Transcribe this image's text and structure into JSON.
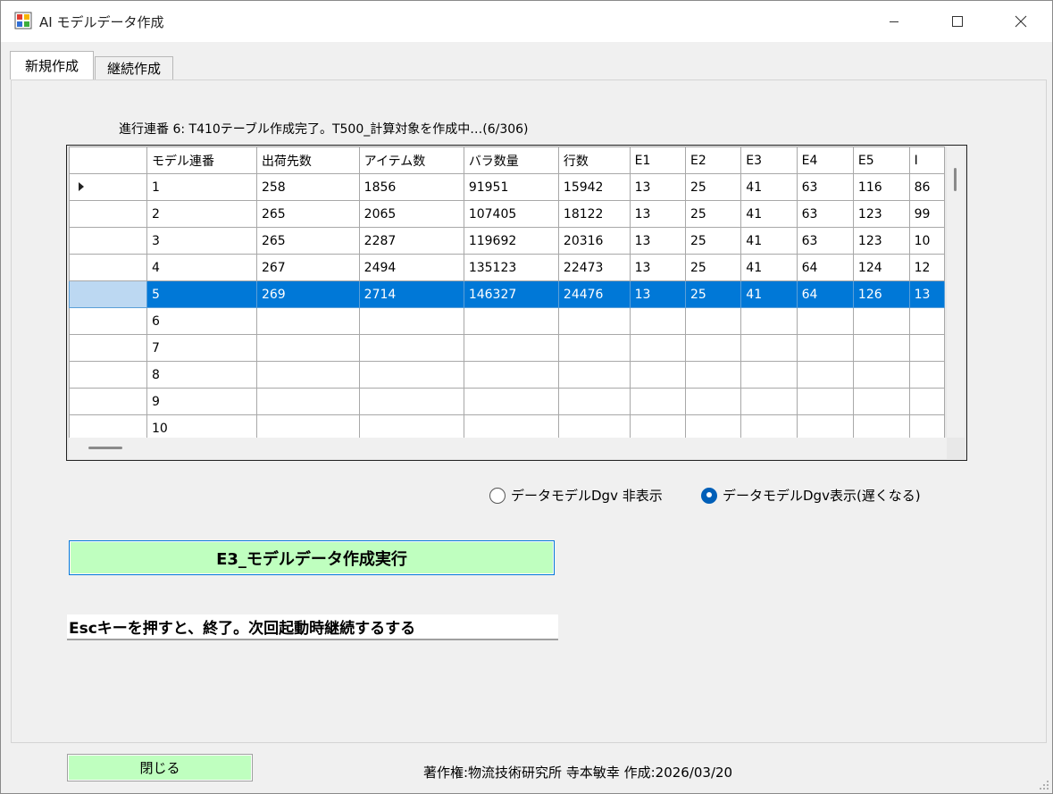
{
  "window": {
    "title": "AI モデルデータ作成",
    "controls": {
      "minimize": "minimize",
      "maximize": "maximize",
      "close": "close"
    }
  },
  "tabs": [
    {
      "label": "新規作成",
      "active": true
    },
    {
      "label": "継続作成",
      "active": false
    }
  ],
  "progress_text": "進行連番 6: T410テーブル作成完了。T500_計算対象を作成中…(6/306)",
  "grid": {
    "columns": [
      "モデル連番",
      "出荷先数",
      "アイテム数",
      "バラ数量",
      "行数",
      "E1",
      "E2",
      "E3",
      "E4",
      "E5",
      "I"
    ],
    "rows": [
      {
        "cells": [
          "1",
          "258",
          "1856",
          "91951",
          "15942",
          "13",
          "25",
          "41",
          "63",
          "116",
          "86"
        ],
        "current": true
      },
      {
        "cells": [
          "2",
          "265",
          "2065",
          "107405",
          "18122",
          "13",
          "25",
          "41",
          "63",
          "123",
          "99"
        ]
      },
      {
        "cells": [
          "3",
          "265",
          "2287",
          "119692",
          "20316",
          "13",
          "25",
          "41",
          "63",
          "123",
          "10"
        ]
      },
      {
        "cells": [
          "4",
          "267",
          "2494",
          "135123",
          "22473",
          "13",
          "25",
          "41",
          "64",
          "124",
          "12"
        ]
      },
      {
        "cells": [
          "5",
          "269",
          "2714",
          "146327",
          "24476",
          "13",
          "25",
          "41",
          "64",
          "126",
          "13"
        ],
        "selected": true
      },
      {
        "cells": [
          "6",
          "",
          "",
          "",
          "",
          "",
          "",
          "",
          "",
          "",
          ""
        ]
      },
      {
        "cells": [
          "7",
          "",
          "",
          "",
          "",
          "",
          "",
          "",
          "",
          "",
          ""
        ]
      },
      {
        "cells": [
          "8",
          "",
          "",
          "",
          "",
          "",
          "",
          "",
          "",
          "",
          ""
        ]
      },
      {
        "cells": [
          "9",
          "",
          "",
          "",
          "",
          "",
          "",
          "",
          "",
          "",
          ""
        ]
      },
      {
        "cells": [
          "10",
          "",
          "",
          "",
          "",
          "",
          "",
          "",
          "",
          "",
          ""
        ]
      }
    ]
  },
  "radio_options": [
    {
      "label": "データモデルDgv 非表示",
      "checked": false
    },
    {
      "label": "データモデルDgv表示(遅くなる)",
      "checked": true
    }
  ],
  "run_button_label": "E3_モデルデータ作成実行",
  "esc_notice": "Escキーを押すと、終了。次回起動時継続するする",
  "close_button_label": "閉じる",
  "copyright": "著作権:物流技術研究所 寺本敏幸 作成:2026/03/20",
  "colors": {
    "selection": "#0078d7",
    "button_green": "#bfffbf",
    "radio_accent": "#005fb8"
  }
}
